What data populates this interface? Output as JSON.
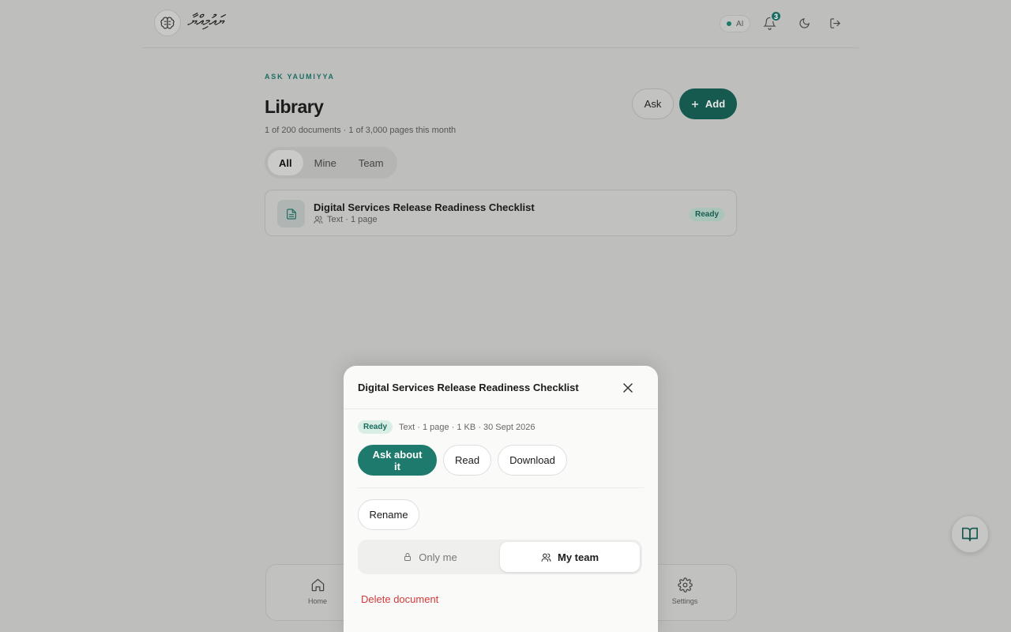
{
  "app": {
    "logo_text": "ޔައުމިއްޔާ",
    "ai_label": "AI",
    "notifications_count": "3",
    "colors": {
      "accent": "#1e7a6d",
      "danger": "#d23a3a",
      "ready_bg": "#d9efe6"
    }
  },
  "library": {
    "eyebrow": "ASK YAUMIYYA",
    "title": "Library",
    "subtitle": "1 of 200 documents · 1 of 3,000 pages this month",
    "ask_label": "Ask",
    "add_label": "Add",
    "tabs": [
      {
        "label": "All",
        "active": true
      },
      {
        "label": "Mine",
        "active": false
      },
      {
        "label": "Team",
        "active": false
      }
    ],
    "documents": [
      {
        "title": "Digital Services Release Readiness Checklist",
        "meta": "Text · 1 page",
        "status": "Ready"
      }
    ]
  },
  "bottom_nav": [
    {
      "label": "Home",
      "icon": "home-icon"
    },
    {
      "label": "Settings",
      "icon": "gear-icon"
    }
  ],
  "modal": {
    "title": "Digital Services Release Readiness Checklist",
    "status": "Ready",
    "meta": "Text · 1 page · 1 KB · 30 Sept 2026",
    "ask_label": "Ask about it",
    "read_label": "Read",
    "download_label": "Download",
    "rename_label": "Rename",
    "visibility": {
      "only_me": "Only me",
      "my_team": "My team",
      "selected": "My team"
    },
    "delete_label": "Delete document"
  }
}
